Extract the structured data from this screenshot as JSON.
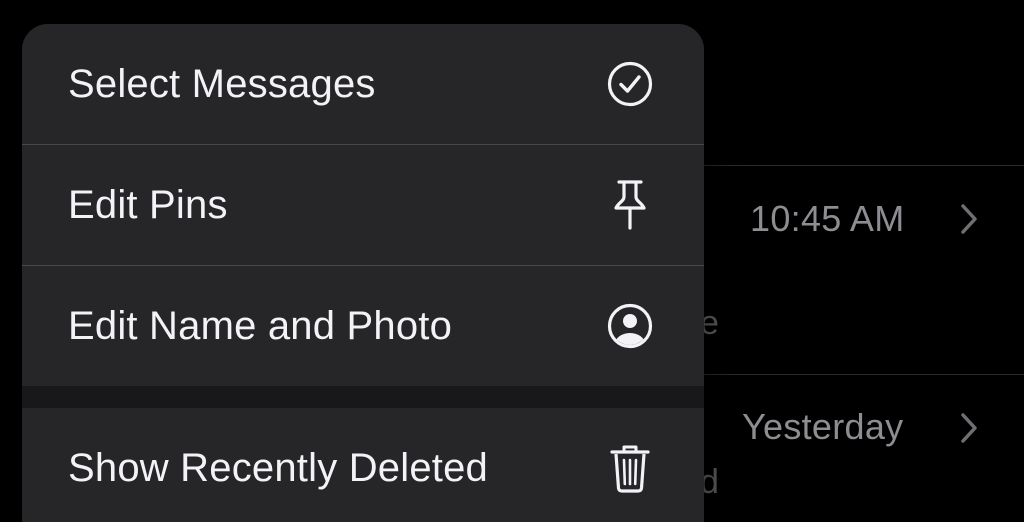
{
  "background_list": {
    "rows": [
      {
        "time": "10:45 AM",
        "preview_fragment": "e"
      },
      {
        "time": "Yesterday",
        "preview_fragment": "d"
      }
    ]
  },
  "context_menu": {
    "items": [
      {
        "label": "Select Messages",
        "icon": "checkmark-circle-icon"
      },
      {
        "label": "Edit Pins",
        "icon": "pin-icon"
      },
      {
        "label": "Edit Name and Photo",
        "icon": "person-circle-icon"
      },
      {
        "label": "Show Recently Deleted",
        "icon": "trash-icon"
      }
    ]
  },
  "colors": {
    "menu_background": "#262628",
    "menu_text": "#f2f2f7",
    "secondary_text": "#8d8d92",
    "screen_background": "#000000"
  }
}
